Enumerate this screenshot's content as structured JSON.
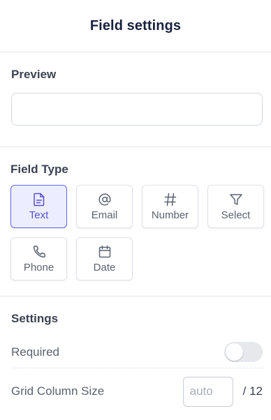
{
  "header": {
    "title": "Field settings"
  },
  "preview": {
    "title": "Preview",
    "input_value": ""
  },
  "field_type": {
    "title": "Field Type",
    "active": "Text",
    "types": [
      {
        "label": "Text",
        "icon": "document-icon",
        "active": true
      },
      {
        "label": "Email",
        "icon": "at-icon",
        "active": false
      },
      {
        "label": "Number",
        "icon": "hash-icon",
        "active": false
      },
      {
        "label": "Select",
        "icon": "filter-icon",
        "active": false
      },
      {
        "label": "Phone",
        "icon": "phone-icon",
        "active": false
      },
      {
        "label": "Date",
        "icon": "calendar-icon",
        "active": false
      }
    ]
  },
  "settings": {
    "title": "Settings",
    "required_label": "Required",
    "required_on": false,
    "grid_label": "Grid Column Size",
    "grid_placeholder": "auto",
    "grid_value": "",
    "grid_suffix": "/ 12"
  },
  "colors": {
    "accent": "#6366f1",
    "accent_bg": "#eceeff",
    "border": "#dfe2e8",
    "text_muted": "#5b6272"
  }
}
